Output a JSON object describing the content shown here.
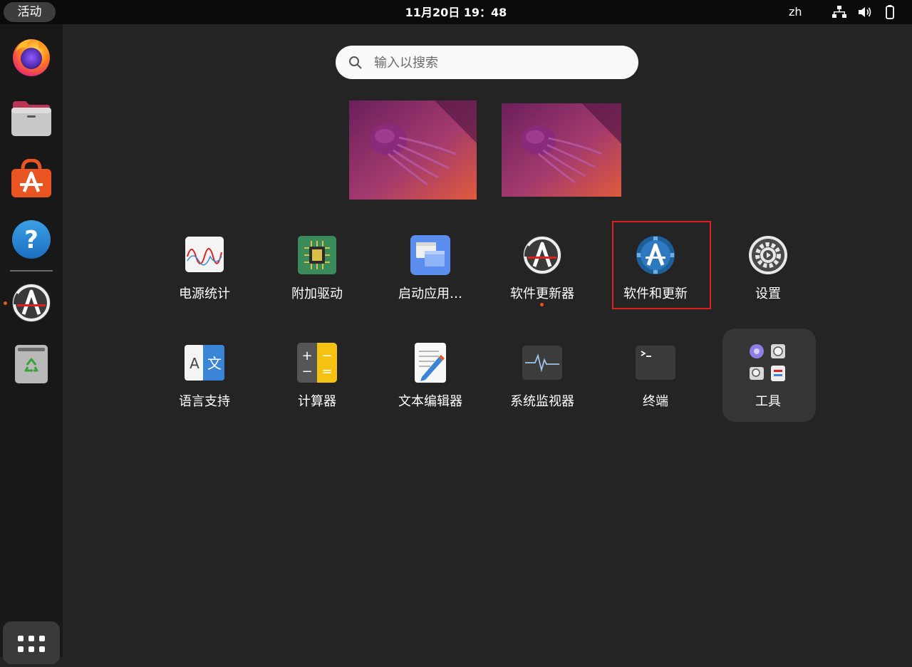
{
  "topbar": {
    "activities_label": "活动",
    "clock": "11月20日  19：48",
    "input_method": "zh",
    "icons": [
      "network-icon",
      "volume-icon",
      "battery-icon"
    ]
  },
  "dock": {
    "items": [
      "firefox",
      "files",
      "app-center",
      "help",
      "software-updater",
      "trash"
    ],
    "show_apps_icon": "grid-icon"
  },
  "search": {
    "placeholder": "输入以搜索",
    "value": ""
  },
  "workspaces": [
    "workspace-1",
    "workspace-2"
  ],
  "apps": {
    "row1": [
      {
        "label": "电源统计",
        "icon": "power-statistics-icon"
      },
      {
        "label": "附加驱动",
        "icon": "additional-drivers-icon"
      },
      {
        "label": "启动应用…",
        "icon": "startup-applications-icon"
      },
      {
        "label": "软件更新器",
        "icon": "software-updater-icon",
        "running": true
      },
      {
        "label": "软件和更新",
        "icon": "software-properties-icon",
        "highlighted": true
      },
      {
        "label": "设置",
        "icon": "settings-icon"
      }
    ],
    "row2": [
      {
        "label": "语言支持",
        "icon": "language-support-icon"
      },
      {
        "label": "计算器",
        "icon": "calculator-icon"
      },
      {
        "label": "文本编辑器",
        "icon": "text-editor-icon"
      },
      {
        "label": "系统监视器",
        "icon": "system-monitor-icon"
      },
      {
        "label": "终端",
        "icon": "terminal-icon"
      },
      {
        "label": "工具",
        "icon": "utilities-folder-icon",
        "folder": true
      }
    ]
  },
  "colors": {
    "accent": "#e95420",
    "highlight_border": "#e0201f",
    "background": "#242424",
    "topbar": "#0b0b0b",
    "dock": "#181818"
  }
}
